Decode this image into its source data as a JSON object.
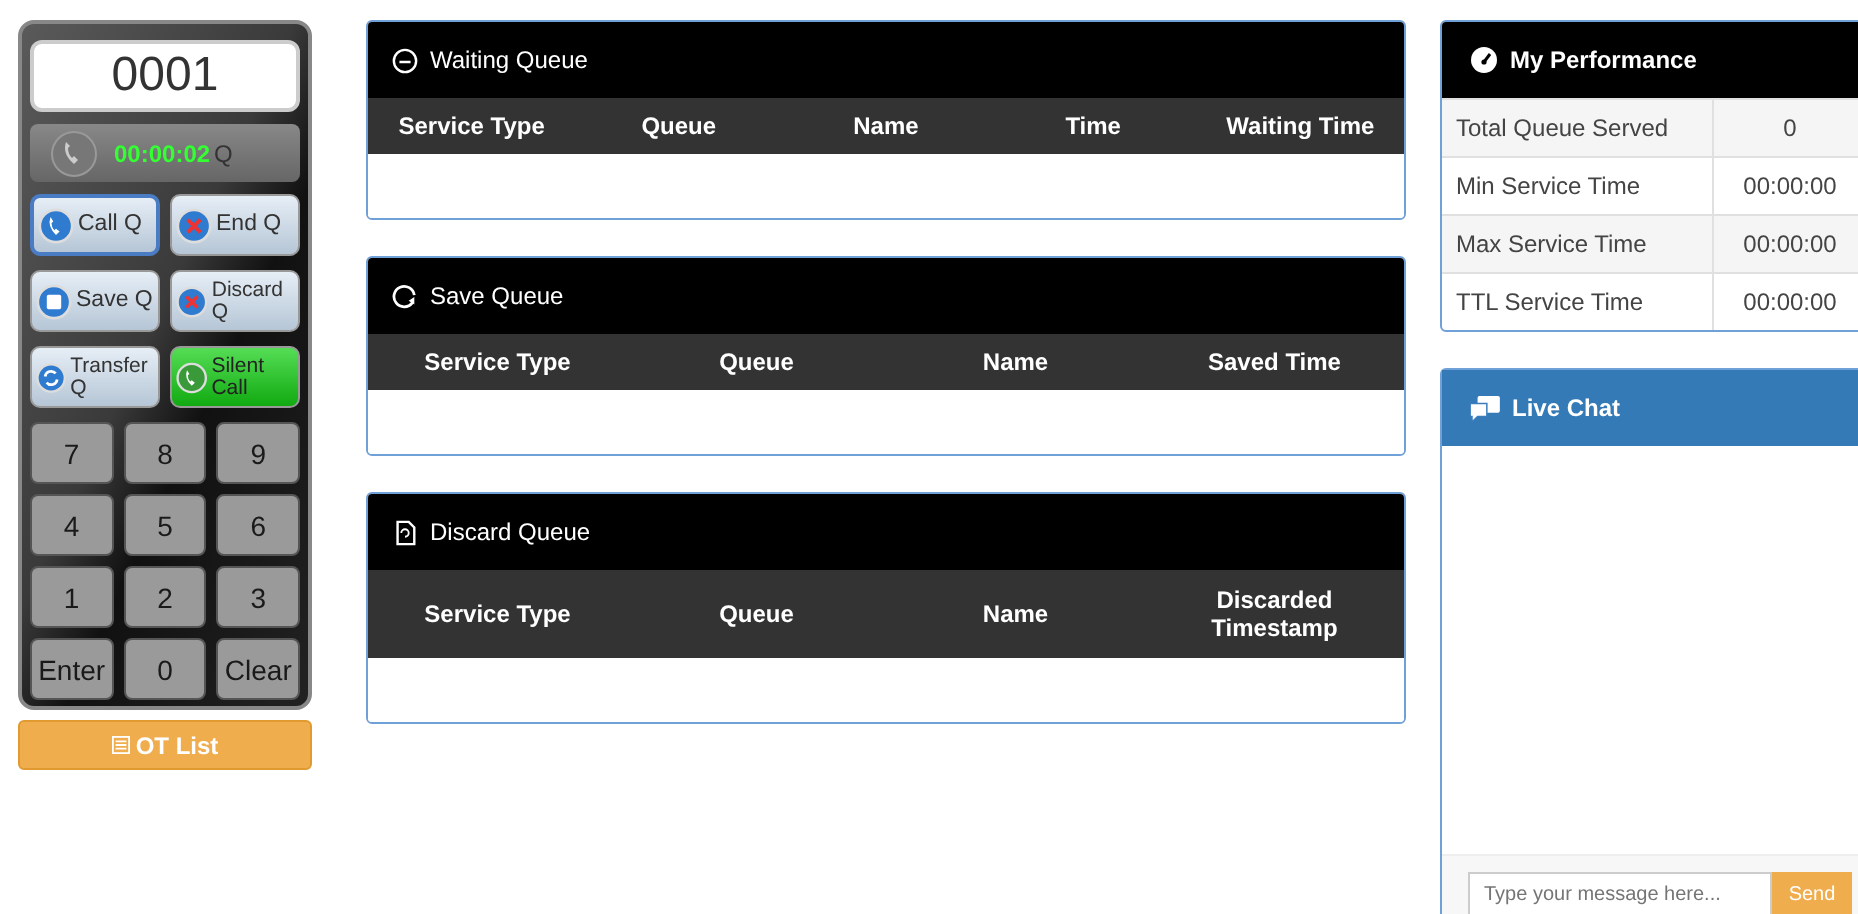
{
  "phone": {
    "display": "0001",
    "timer": "00:00:02",
    "timer_suffix": "Q",
    "actions": [
      {
        "label": "Call Q",
        "kind": "phone",
        "active": false,
        "focused": true
      },
      {
        "label": "End Q",
        "kind": "cross",
        "active": false,
        "focused": false
      },
      {
        "label": "Save Q",
        "kind": "disk",
        "active": false,
        "focused": false
      },
      {
        "label": "Discard Q",
        "kind": "cross",
        "active": false,
        "focused": false
      },
      {
        "label": "Transfer Q",
        "kind": "transfer",
        "active": false,
        "focused": false
      },
      {
        "label": "Silent Call",
        "kind": "phone",
        "active": true,
        "focused": false
      }
    ],
    "keys": [
      "7",
      "8",
      "9",
      "4",
      "5",
      "6",
      "1",
      "2",
      "3",
      "Enter",
      "0",
      "Clear"
    ]
  },
  "ot_list_button": "OT List",
  "queues": [
    {
      "title": "Waiting Queue",
      "kind": "clock",
      "columns": [
        "Service Type",
        "Queue",
        "Name",
        "Time",
        "Waiting Time"
      ]
    },
    {
      "title": "Save Queue",
      "kind": "refresh",
      "columns": [
        "Service Type",
        "Queue",
        "Name",
        "Saved Time"
      ]
    },
    {
      "title": "Discard Queue",
      "kind": "file",
      "columns": [
        "Service Type",
        "Queue",
        "Name",
        "Discarded Timestamp"
      ]
    }
  ],
  "performance": {
    "title": "My Performance",
    "rows": [
      {
        "label": "Total Queue Served",
        "value": "0"
      },
      {
        "label": "Min Service Time",
        "value": "00:00:00"
      },
      {
        "label": "Max Service Time",
        "value": "00:00:00"
      },
      {
        "label": "TTL Service Time",
        "value": "00:00:00"
      }
    ]
  },
  "live_chat": {
    "title": "Live Chat",
    "placeholder": "Type your message here...",
    "send": "Send"
  }
}
